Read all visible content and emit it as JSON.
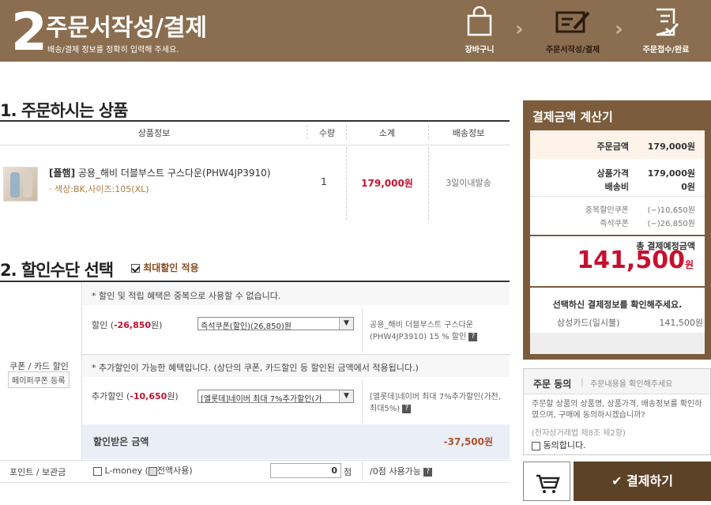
{
  "header": {
    "step_number": "2",
    "title": "주문서작성/결제",
    "subtitle": "배송/결제 정보를 정확히 입력해 주세요.",
    "steps": [
      {
        "label": "장바구니",
        "icon": "shopping-bag-icon"
      },
      {
        "label": "주문서작성/결제",
        "icon": "order-form-icon"
      },
      {
        "label": "주문접수/완료",
        "icon": "checklist-icon"
      }
    ],
    "chevron": "›"
  },
  "products_section": {
    "title": "1. 주문하시는 상품",
    "columns": [
      "상품정보",
      "수량",
      "소계",
      "배송정보"
    ],
    "items": [
      {
        "brand": "[폴햄]",
        "name": " 공용_해비 더블부스트 구스다운(PHW4JP3910)",
        "option": "· 색상:BK,사이즈:105(XL)",
        "qty": "1",
        "subtotal": "179,000원",
        "shipping": "3일이내발송"
      }
    ]
  },
  "discount_section": {
    "title": "2. 할인수단 선택",
    "max_discount_label": "최대할인 적용",
    "row_label": "쿠폰 / 카드 할인",
    "paper_coupon_button": "페이퍼쿠폰 등록",
    "notice1": "* 할인 및 적립 혜택은 중복으로 사용할 수 없습니다.",
    "discount_label": "할인 (",
    "discount_amount": "-26,850",
    "discount_suffix": "원)",
    "discount_select": "즉석쿠폰(할인)(26,850)원",
    "discount_desc": "공용_해비 더블부스트 구스다운(PHW4JP3910) 15 % 할인",
    "notice2": "* 추가할인이 가능한 혜택입니다. (상단의 쿠폰, 카드할인 등 할인된 금액에서 적용됩니다.)",
    "extra_label": "추가할인 (",
    "extra_amount": "-10,650",
    "extra_suffix": "원)",
    "extra_select": "[엘롯데]네이버 최대 7%추가할인(가",
    "extra_desc": "[엘롯데]네이버 최대 7%추가할인(가전,최대5%)",
    "received_label": "할인받은 금액",
    "received_amount": "-37,500원",
    "points_label": "포인트 / 보관금",
    "lmoney_label": "L-money (",
    "use_all_label": "전액사용)",
    "points_value": "0",
    "points_unit": "점",
    "points_available": "/0점 사용가능"
  },
  "calculator": {
    "title": "결제금액 계산기",
    "order_amount_label": "주문금액",
    "order_amount": "179,000원",
    "product_price_label": "상품가격",
    "product_price": "179,000원",
    "shipping_label": "배송비",
    "shipping": "0원",
    "dup_coupon_label": "중복할인쿠폰",
    "dup_coupon": "(−)10,650원",
    "instant_coupon_label": "즉석쿠폰",
    "instant_coupon": "(−)26,850원",
    "total_label": "총 결제예정금액",
    "total": "141,500",
    "total_unit": "원",
    "confirm_label": "선택하신 결제정보를 확인해주세요.",
    "pay_method": "삼성카드(일시불)",
    "pay_amount": "141,500원"
  },
  "agreement": {
    "title": "주문 동의",
    "sep": "|",
    "hint": "주문내용을 확인해주세요",
    "body": "주문할 상품의 상품명, 상품가격, 배송정보를 확인하였으며, 구매에 동의하시겠습니까?",
    "law": "(전자상거래법 제8조 제2항)",
    "agree_label": "동의합니다."
  },
  "actions": {
    "pay_button": "결제하기"
  },
  "colors": {
    "header_bg": "#8a6e4f",
    "accent_red": "#c8102e",
    "pay_button": "#5c4226"
  }
}
